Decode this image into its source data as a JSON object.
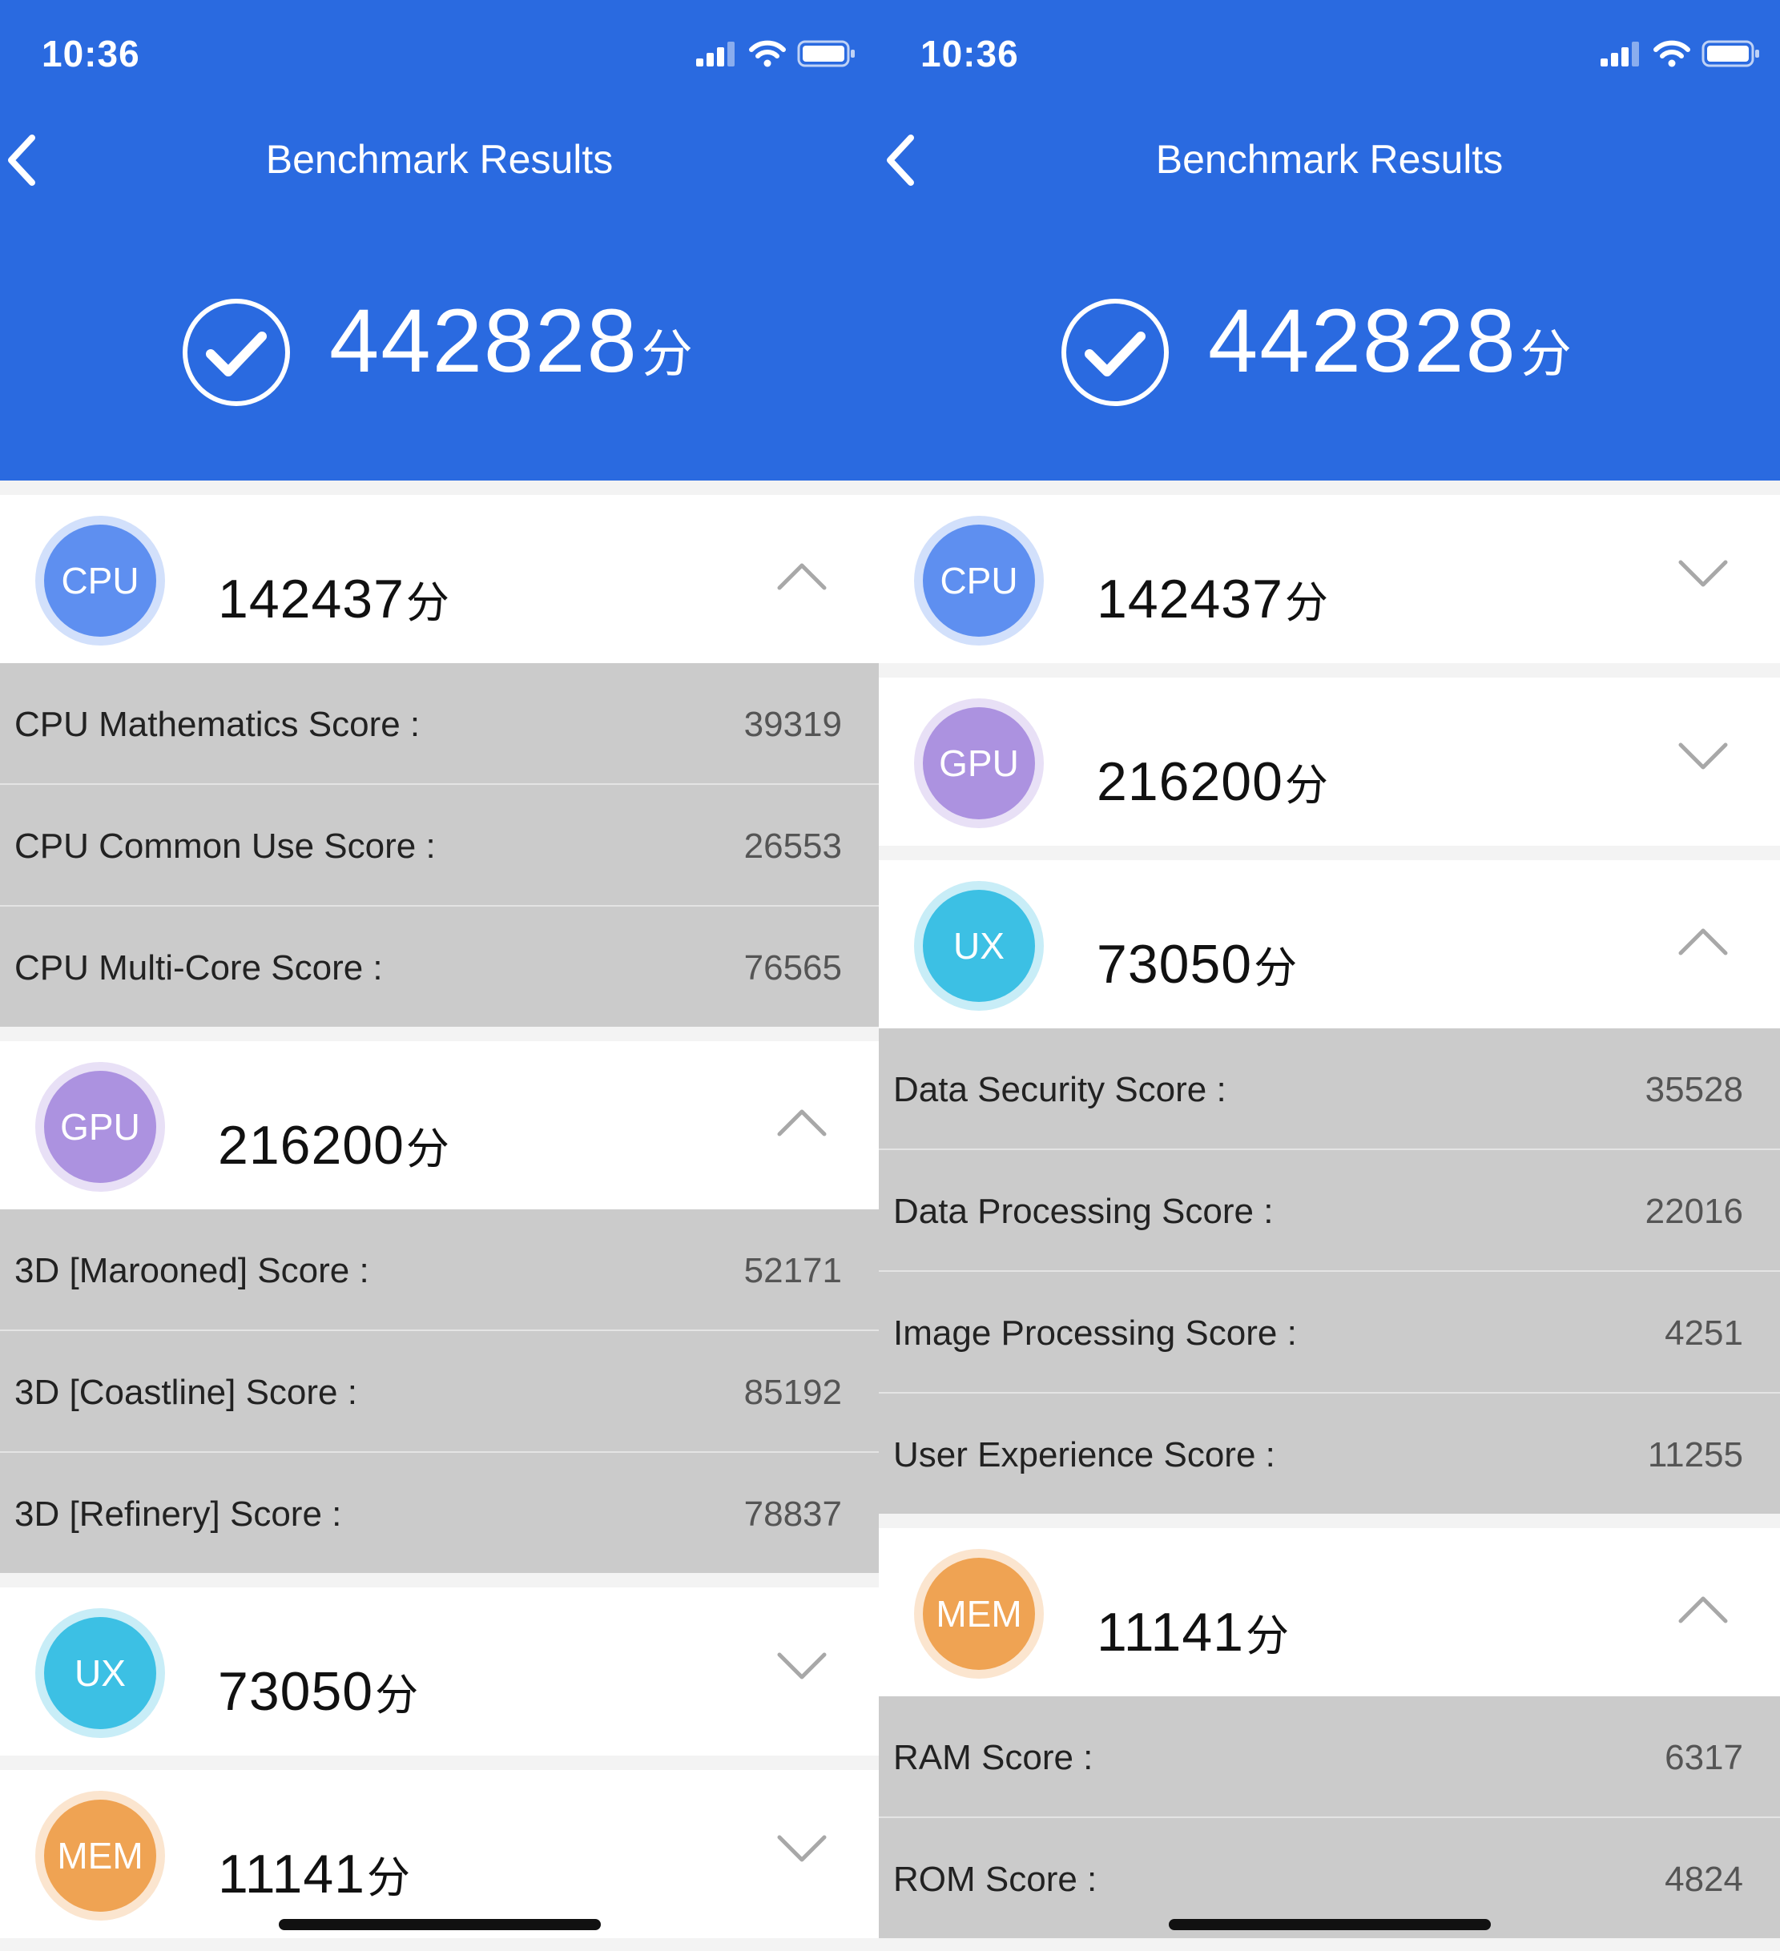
{
  "colors": {
    "header": "#2a6ae0",
    "cpu": "#5e8ff0",
    "gpu": "#ac92e0",
    "ux": "#3cc0e4",
    "mem": "#efa353"
  },
  "panels": [
    {
      "status_time": "10:36",
      "title": "Benchmark Results",
      "total_score": "442828",
      "unit": "分",
      "categories": [
        {
          "badge": "CPU",
          "score": "142437",
          "expanded": true,
          "items": [
            {
              "label": "CPU Mathematics Score :",
              "value": "39319"
            },
            {
              "label": "CPU Common Use Score :",
              "value": "26553"
            },
            {
              "label": "CPU Multi-Core Score :",
              "value": "76565"
            }
          ]
        },
        {
          "badge": "GPU",
          "score": "216200",
          "expanded": true,
          "items": [
            {
              "label": "3D [Marooned] Score :",
              "value": "52171"
            },
            {
              "label": "3D [Coastline] Score :",
              "value": "85192"
            },
            {
              "label": "3D [Refinery] Score :",
              "value": "78837"
            }
          ]
        },
        {
          "badge": "UX",
          "score": "73050",
          "expanded": false,
          "items": []
        },
        {
          "badge": "MEM",
          "score": "11141",
          "expanded": false,
          "items": []
        }
      ]
    },
    {
      "status_time": "10:36",
      "title": "Benchmark Results",
      "total_score": "442828",
      "unit": "分",
      "categories": [
        {
          "badge": "CPU",
          "score": "142437",
          "expanded": false,
          "items": []
        },
        {
          "badge": "GPU",
          "score": "216200",
          "expanded": false,
          "items": []
        },
        {
          "badge": "UX",
          "score": "73050",
          "expanded": true,
          "items": [
            {
              "label": "Data Security Score :",
              "value": "35528"
            },
            {
              "label": "Data Processing Score :",
              "value": "22016"
            },
            {
              "label": "Image Processing Score :",
              "value": "4251"
            },
            {
              "label": "User Experience Score :",
              "value": "11255"
            }
          ]
        },
        {
          "badge": "MEM",
          "score": "11141",
          "expanded": true,
          "items": [
            {
              "label": "RAM Score :",
              "value": "6317"
            },
            {
              "label": "ROM Score :",
              "value": "4824"
            }
          ]
        }
      ]
    }
  ]
}
